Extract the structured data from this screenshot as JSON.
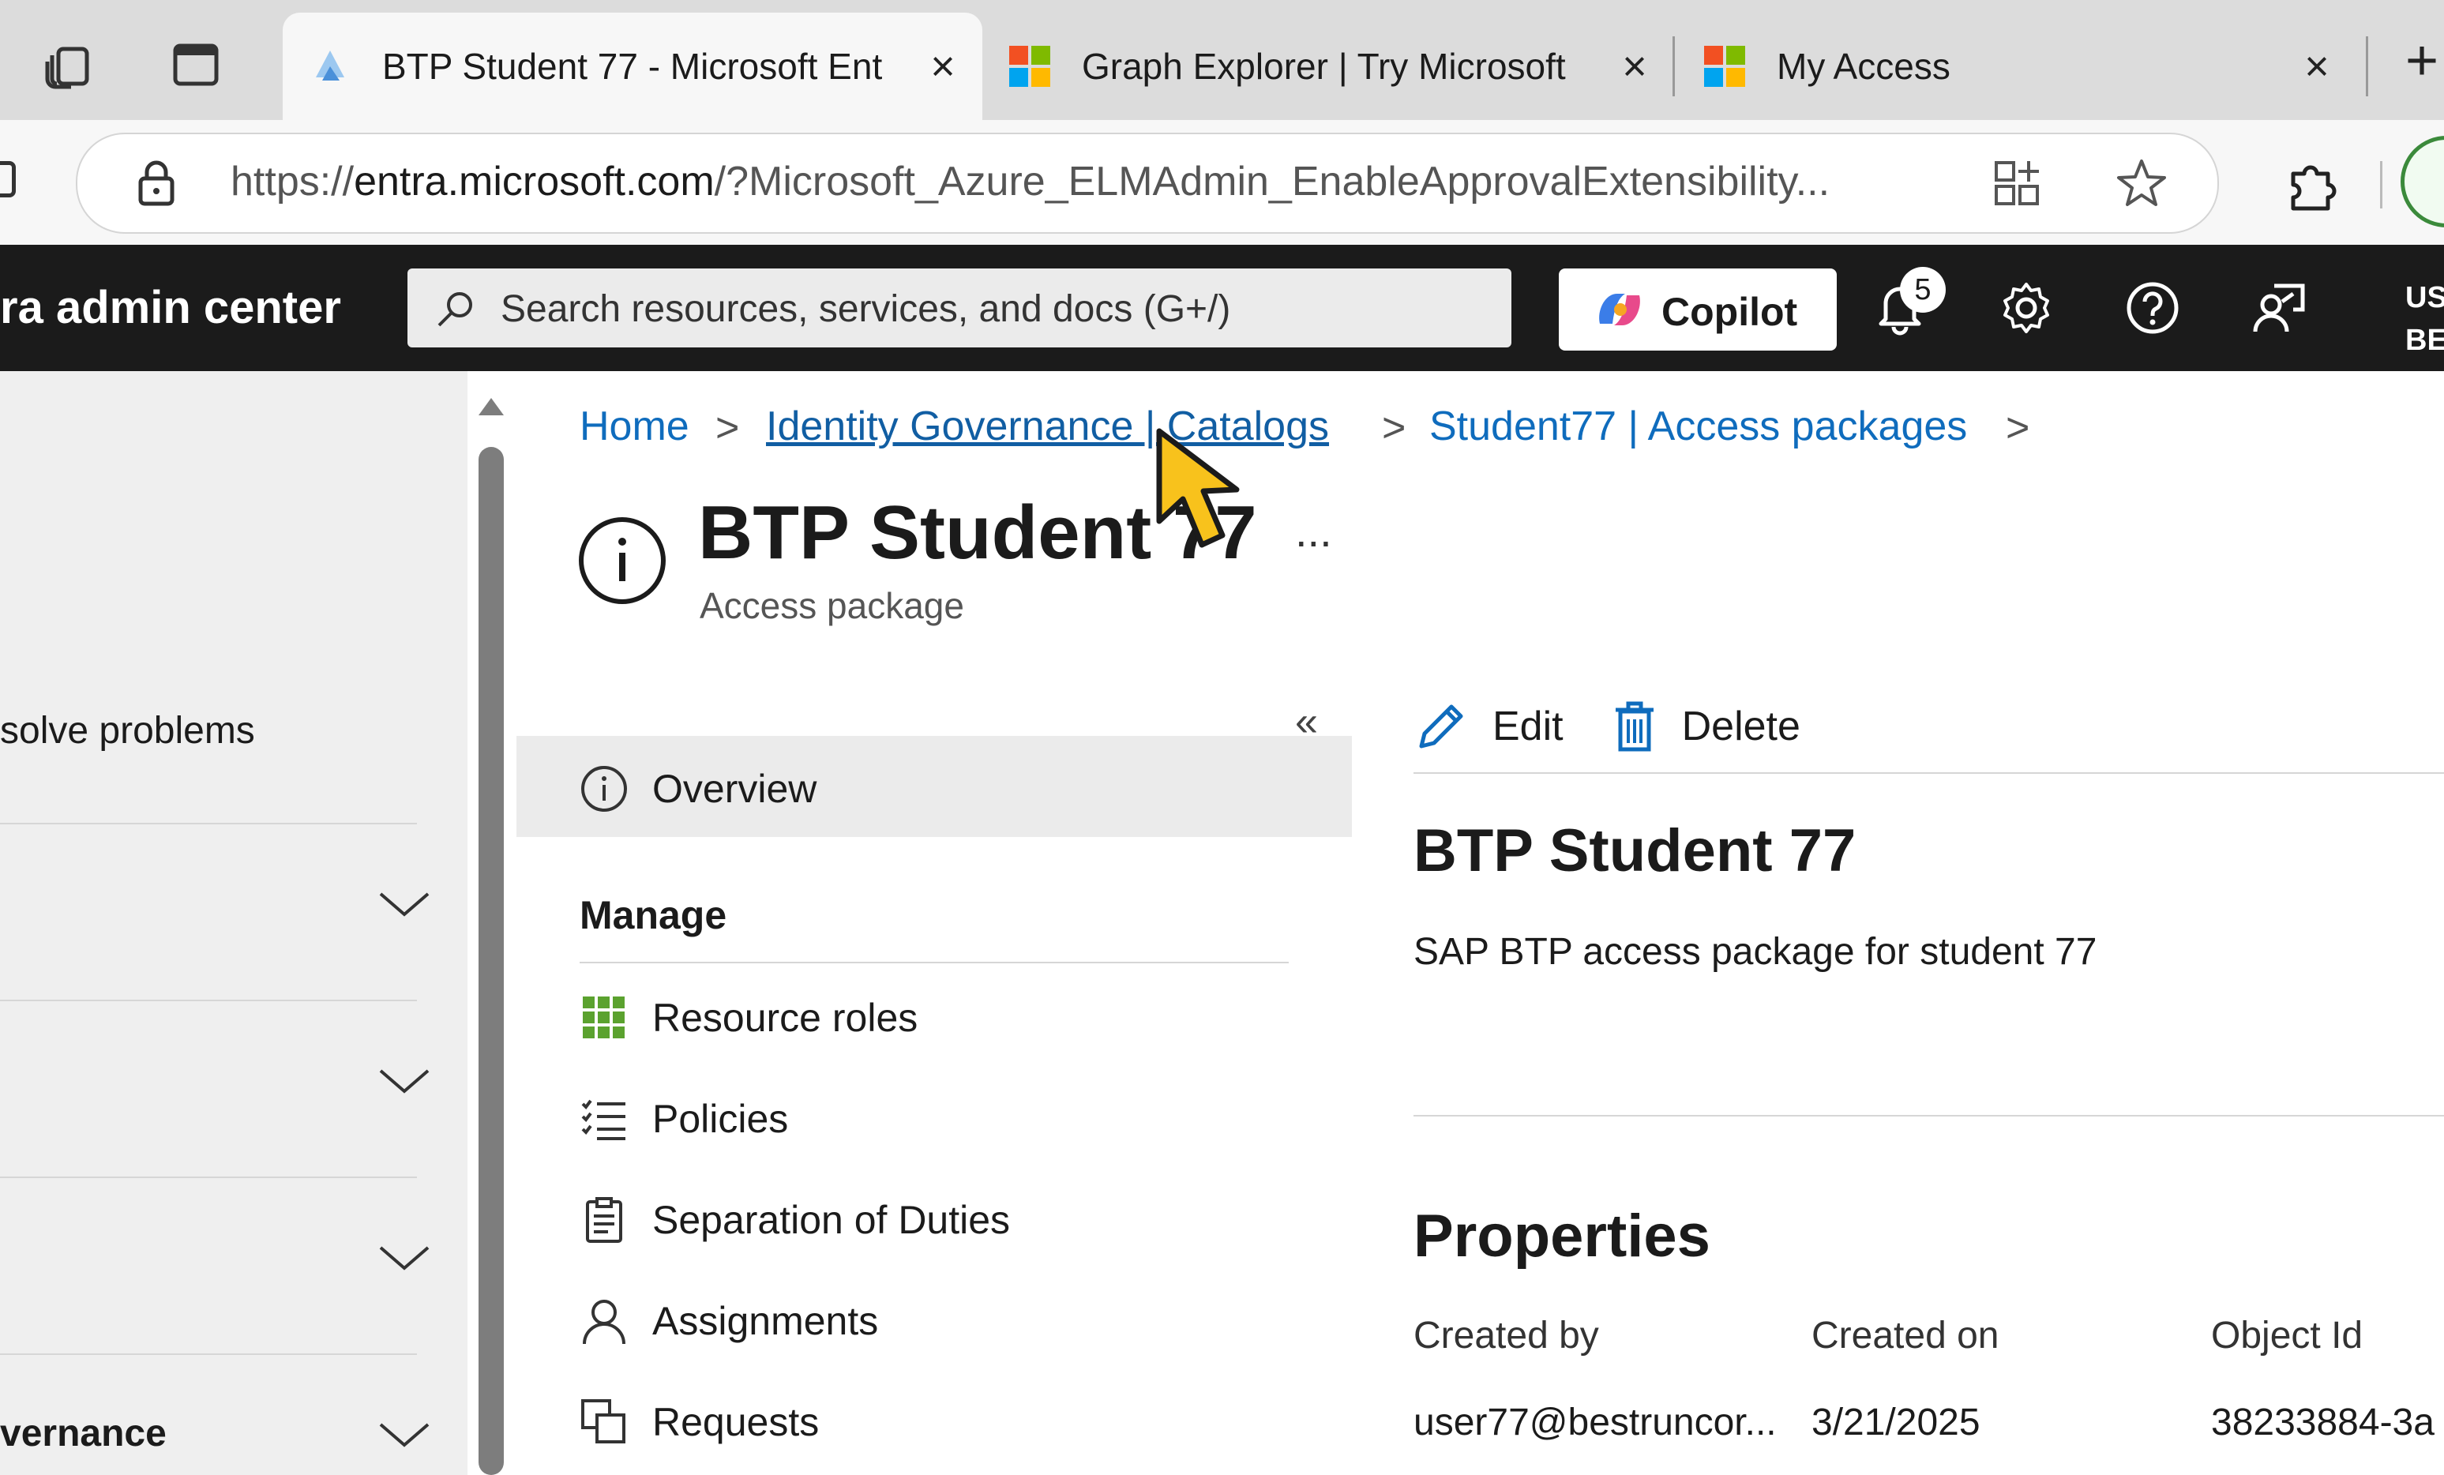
{
  "browser": {
    "tabs": [
      {
        "title": "BTP Student 77 - Microsoft Ent",
        "active": true,
        "icon": "entra-icon"
      },
      {
        "title": "Graph Explorer | Try Microsoft",
        "active": false,
        "icon": "microsoft-logo"
      },
      {
        "title": "My Access",
        "active": false,
        "icon": "microsoft-logo"
      }
    ],
    "url_prefix": "https://",
    "url_domain": "entra.microsoft.com",
    "url_rest": "/?Microsoft_Azure_ELMAdmin_EnableApprovalExtensibility..."
  },
  "portal": {
    "brand": "ra admin center",
    "search_placeholder": "Search resources, services, and docs (G+/)",
    "copilot_label": "Copilot",
    "notification_count": "5",
    "user_line1": "US",
    "user_line2": "BES"
  },
  "leftnav": {
    "items": [
      "solve problems",
      "vernance"
    ]
  },
  "breadcrumb": {
    "home": "Home",
    "catalogs": "Identity Governance | Catalogs",
    "packages": "Student77 | Access packages"
  },
  "page": {
    "title": "BTP Student 77",
    "subtitle": "Access package",
    "more": "..."
  },
  "subnav": {
    "overview": "Overview",
    "manage_heading": "Manage",
    "items": [
      "Resource roles",
      "Policies",
      "Separation of Duties",
      "Assignments",
      "Requests"
    ]
  },
  "commands": {
    "edit": "Edit",
    "delete": "Delete"
  },
  "content": {
    "title": "BTP Student 77",
    "description": "SAP BTP access package for student 77",
    "properties_heading": "Properties",
    "created_by_label": "Created by",
    "created_on_label": "Created on",
    "object_id_label": "Object Id",
    "created_by": "user77@bestruncor...",
    "created_on": "3/21/2025",
    "object_id": "38233884-3a"
  },
  "colors": {
    "link": "#0f6cbd",
    "header_bg": "#1b1b1b",
    "icon_blue": "#0f6cbd",
    "resource_green": "#5ba22f"
  }
}
